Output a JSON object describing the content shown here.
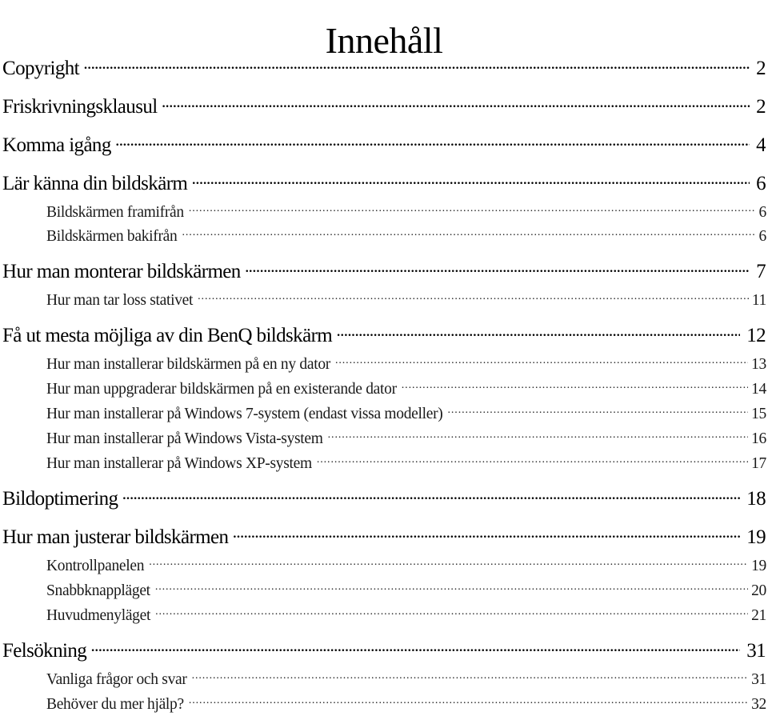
{
  "page": {
    "title": "Innehåll"
  },
  "toc": {
    "entries": [
      {
        "level": 1,
        "label": "Copyright",
        "page": "2"
      },
      {
        "level": 1,
        "label": "Friskrivningsklausul",
        "page": "2"
      },
      {
        "level": 1,
        "label": "Komma igång",
        "page": "4"
      },
      {
        "level": 1,
        "label": "Lär känna din bildskärm",
        "page": "6"
      },
      {
        "level": 2,
        "label": "Bildskärmen framifrån",
        "page": "6"
      },
      {
        "level": 2,
        "label": "Bildskärmen bakifrån",
        "page": "6"
      },
      {
        "level": 1,
        "label": "Hur man monterar bildskärmen",
        "page": "7"
      },
      {
        "level": 2,
        "label": "Hur man tar loss stativet",
        "page": "11"
      },
      {
        "level": 1,
        "label": "Få ut mesta möjliga av din BenQ bildskärm",
        "page": "12"
      },
      {
        "level": 2,
        "label": "Hur man installerar bildskärmen på en ny dator",
        "page": "13"
      },
      {
        "level": 2,
        "label": "Hur man uppgraderar bildskärmen på en existerande dator",
        "page": "14"
      },
      {
        "level": 2,
        "label": "Hur man installerar på Windows 7-system (endast vissa modeller)",
        "page": "15"
      },
      {
        "level": 2,
        "label": "Hur man installerar på Windows Vista-system",
        "page": "16"
      },
      {
        "level": 2,
        "label": "Hur man installerar på Windows XP-system",
        "page": "17"
      },
      {
        "level": 1,
        "label": "Bildoptimering",
        "page": "18"
      },
      {
        "level": 1,
        "label": "Hur man justerar bildskärmen",
        "page": "19"
      },
      {
        "level": 2,
        "label": "Kontrollpanelen",
        "page": "19"
      },
      {
        "level": 2,
        "label": "Snabbknappläget",
        "page": "20"
      },
      {
        "level": 2,
        "label": "Huvudmenyläget",
        "page": "21"
      },
      {
        "level": 1,
        "label": "Felsökning",
        "page": "31"
      },
      {
        "level": 2,
        "label": "Vanliga frågor och svar",
        "page": "31"
      },
      {
        "level": 2,
        "label": "Behöver du mer hjälp?",
        "page": "32"
      }
    ]
  }
}
